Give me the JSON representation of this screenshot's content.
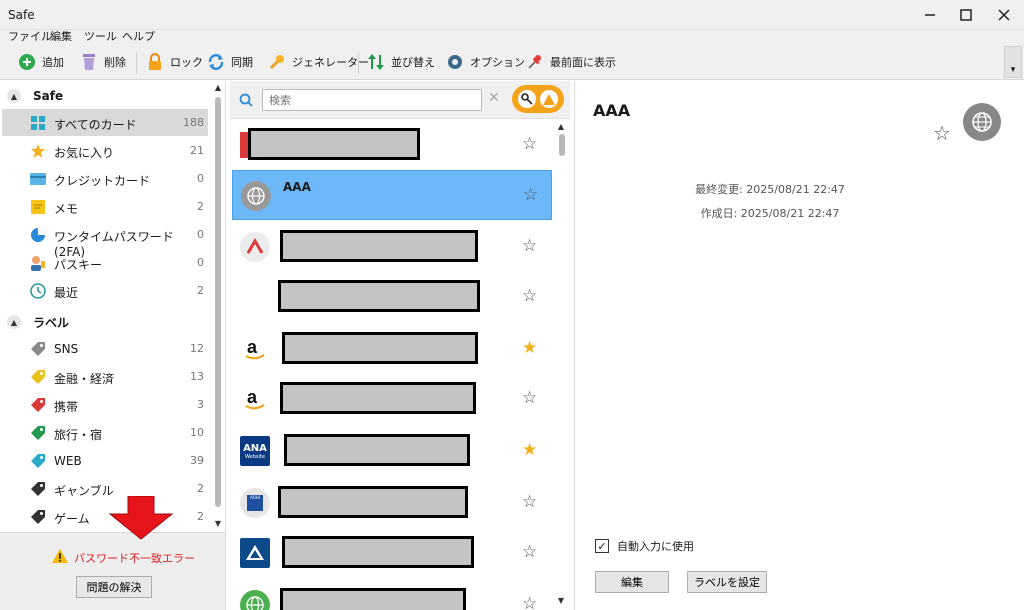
{
  "window": {
    "title": "Safe",
    "controls": [
      "minimize-icon",
      "maximize-icon",
      "close-icon"
    ]
  },
  "menu": [
    "ファイル",
    "編集",
    "ツール",
    "ヘルプ"
  ],
  "toolbar": {
    "add": "追加",
    "delete": "削除",
    "lock": "ロック",
    "sync": "同期",
    "generator": "ジェネレーター",
    "sort": "並び替え",
    "options": "オプション",
    "topmost": "最前面に表示"
  },
  "sidebar": {
    "safe_header": "Safe",
    "safe_items": [
      {
        "label": "すべてのカード",
        "count": "188",
        "icon": "grid-icon"
      },
      {
        "label": "お気に入り",
        "count": "21",
        "icon": "star-icon"
      },
      {
        "label": "クレジットカード",
        "count": "0",
        "icon": "credit-card-icon"
      },
      {
        "label": "メモ",
        "count": "2",
        "icon": "note-icon"
      },
      {
        "label": "ワンタイムパスワード (2FA)",
        "count": "0",
        "icon": "otp-icon"
      },
      {
        "label": "パスキー",
        "count": "0",
        "icon": "passkey-icon"
      },
      {
        "label": "最近",
        "count": "2",
        "icon": "clock-icon"
      }
    ],
    "label_header": "ラベル",
    "label_items": [
      {
        "label": "SNS",
        "count": "12",
        "color": "#8a8a8a"
      },
      {
        "label": "金融・経済",
        "count": "13",
        "color": "#e6c21a"
      },
      {
        "label": "携帯",
        "count": "3",
        "color": "#d93a3a"
      },
      {
        "label": "旅行・宿",
        "count": "10",
        "color": "#1f9a4a"
      },
      {
        "label": "WEB",
        "count": "39",
        "color": "#2aa9c9"
      },
      {
        "label": "ギャンブル",
        "count": "2",
        "color": "#333333"
      },
      {
        "label": "ゲーム",
        "count": "2",
        "color": "#333333"
      }
    ]
  },
  "footer": {
    "error": "パスワード不一致エラー",
    "fix_button": "問題の解決"
  },
  "search": {
    "placeholder": "検索"
  },
  "list": {
    "rows": [
      {
        "title": "",
        "starred": false,
        "logo": "red-logo"
      },
      {
        "title": "AAA",
        "starred": false,
        "logo": "globe-icon",
        "selected": true
      },
      {
        "title": "",
        "starred": false,
        "logo": "red-chevron-logo"
      },
      {
        "title": "",
        "starred": false,
        "logo": "blank-logo"
      },
      {
        "title": "",
        "starred": true,
        "logo": "amazon-logo"
      },
      {
        "title": "",
        "starred": false,
        "logo": "amazon-logo"
      },
      {
        "title": "",
        "starred": true,
        "logo": "ana-logo"
      },
      {
        "title": "",
        "starred": false,
        "logo": "aohi-logo"
      },
      {
        "title": "",
        "starred": false,
        "logo": "blue-mountain-logo"
      },
      {
        "title": "",
        "starred": false,
        "logo": "green-globe-logo"
      }
    ],
    "amazon_letter": "a",
    "ana_text": "ANA",
    "ana_sub": "Website",
    "aohi_text": "AOHI"
  },
  "detail": {
    "title": "AAA",
    "modified": "最終変更: 2025/08/21 22:47",
    "created": "作成日: 2025/08/21 22:47",
    "autofill_label": "自動入力に使用",
    "autofill_checked": true,
    "edit_button": "編集",
    "label_button": "ラベルを設定"
  },
  "colors": {
    "accent": "#6cb8f8",
    "error": "#e02020",
    "favorite": "#f3b21b",
    "filter": "#f5a31a"
  }
}
